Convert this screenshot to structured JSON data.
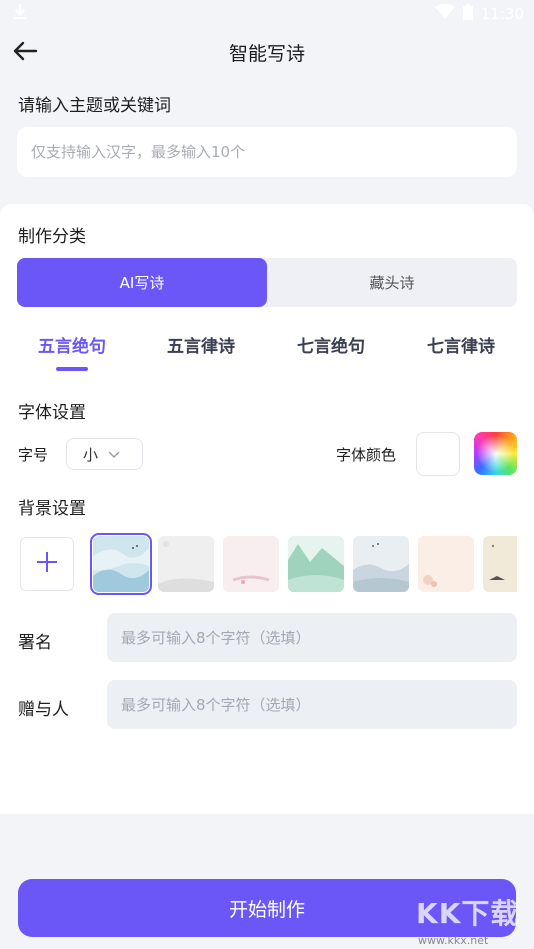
{
  "status_bar": {
    "time": "11:30"
  },
  "header": {
    "title": "智能写诗"
  },
  "topic": {
    "label": "请输入主题或关键词",
    "placeholder": "仅支持输入汉字，最多输入10个"
  },
  "category": {
    "label": "制作分类",
    "options": [
      "AI写诗",
      "藏头诗"
    ],
    "selected": "AI写诗"
  },
  "poem_forms": {
    "tabs": [
      "五言绝句",
      "五言律诗",
      "七言绝句",
      "七言律诗"
    ],
    "selected": "五言绝句"
  },
  "font_settings": {
    "label": "字体设置",
    "size_label": "字号",
    "size_value": "小",
    "color_label": "字体颜色",
    "selected_color": "#ffffff"
  },
  "background": {
    "label": "背景设置",
    "thumbnails": [
      "ink-landscape-blue",
      "gray-paper",
      "pink-paper",
      "green-mountains",
      "misty-landscape",
      "peach-paper",
      "beige-figure"
    ],
    "selected_index": 0
  },
  "signature": {
    "label": "署名",
    "placeholder": "最多可输入8个字符（选填）"
  },
  "recipient": {
    "label": "赠与人",
    "placeholder": "最多可输入8个字符（选填）"
  },
  "actions": {
    "start_label": "开始制作"
  },
  "watermark": {
    "brand": "KK下载",
    "url": "www.kkx.net"
  },
  "colors": {
    "accent": "#6b57f7",
    "page_bg": "#f3f4f8"
  }
}
